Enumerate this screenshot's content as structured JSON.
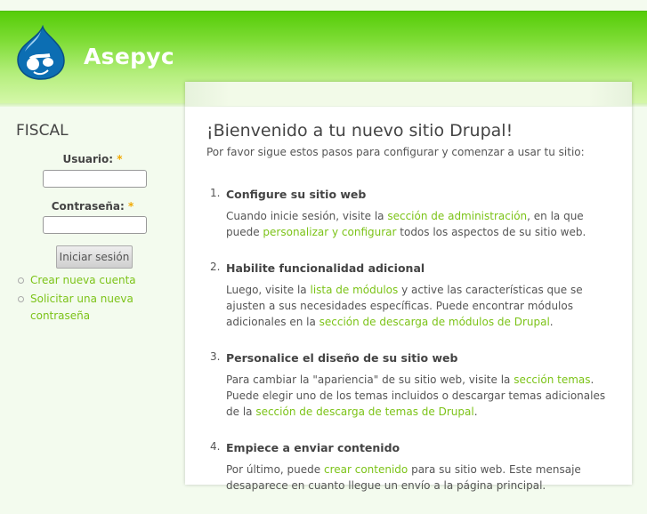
{
  "header": {
    "site_name": "Asepyc"
  },
  "sidebar": {
    "title": "FISCAL",
    "username_label": "Usuario:",
    "password_label": "Contraseña:",
    "required_mark": "*",
    "login_button": "Iniciar sesión",
    "links": [
      "Crear nueva cuenta",
      "Solicitar una nueva contraseña"
    ]
  },
  "main": {
    "title": "¡Bienvenido a tu nuevo sitio Drupal!",
    "intro": "Por favor sigue estos pasos para configurar y comenzar a usar tu sitio:",
    "steps": [
      {
        "num": "1.",
        "title": "Configure su sitio web",
        "t0": "Cuando inicie sesión, visite la ",
        "l0": "sección de administración",
        "t1": ", en la que puede ",
        "l1": "personalizar y configurar",
        "t2": " todos los aspectos de su sitio web."
      },
      {
        "num": "2.",
        "title": "Habilite funcionalidad adicional",
        "t0": "Luego, visite la ",
        "l0": "lista de módulos",
        "t1": " y active las características que se ajusten a sus necesidades específicas. Puede encontrar módulos adicionales en la ",
        "l1": "sección de descarga de módulos de Drupal",
        "t2": "."
      },
      {
        "num": "3.",
        "title": "Personalice el diseño de su sitio web",
        "t0": "Para cambiar la \"apariencia\" de su sitio web, visite la ",
        "l0": "sección temas",
        "t1": ". Puede elegir uno de los temas incluidos o descargar temas adicionales de la ",
        "l1": "sección de descarga de temas de Drupal",
        "t2": "."
      },
      {
        "num": "4.",
        "title": "Empiece a enviar contenido",
        "t0": "Por último, puede ",
        "l0": "crear contenido",
        "t1": " para su sitio web. Este mensaje desaparece en cuanto llegue un envío a la página principal."
      }
    ]
  }
}
